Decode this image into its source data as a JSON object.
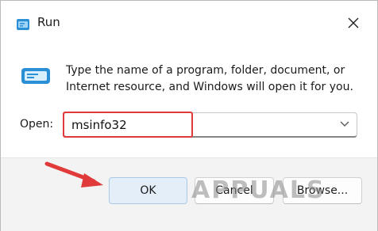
{
  "window": {
    "title": "Run",
    "description": "Type the name of a program, folder, document, or Internet resource, and Windows will open it for you."
  },
  "icons": {
    "app": "run-app-icon",
    "big": "run-dialog-icon",
    "close": "close-icon",
    "dropdown": "chevron-down-icon",
    "arrow": "red-arrow-annotation"
  },
  "open": {
    "label": "Open:",
    "value": "msinfo32"
  },
  "buttons": {
    "ok": "OK",
    "cancel": "Cancel",
    "browse": "Browse..."
  },
  "watermark": {
    "text": "APPUALS"
  },
  "colors": {
    "highlight": "#e13a3a",
    "arrow": "#e13a3a",
    "icon_blue": "#2b8fd6",
    "footer": "#f3f3f3"
  }
}
